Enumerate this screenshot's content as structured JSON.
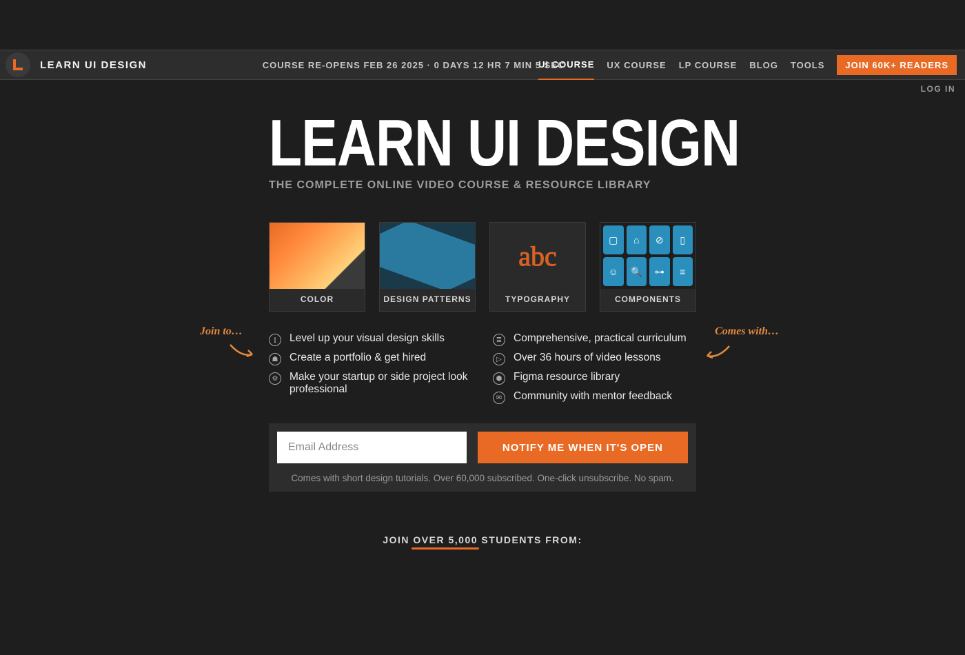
{
  "header": {
    "brand": "LEARN UI DESIGN",
    "countdown": "COURSE RE-OPENS FEB 26 2025 · 0 DAYS 12 HR 7 MIN 5 SEC",
    "nav": [
      {
        "label": "UI COURSE",
        "active": true
      },
      {
        "label": "UX COURSE",
        "active": false
      },
      {
        "label": "LP COURSE",
        "active": false
      },
      {
        "label": "BLOG",
        "active": false
      },
      {
        "label": "TOOLS",
        "active": false
      }
    ],
    "cta": "JOIN 60K+ READERS",
    "login": "LOG IN"
  },
  "hero": {
    "title": "LEARN UI DESIGN",
    "subtitle": "THE COMPLETE ONLINE VIDEO COURSE & RESOURCE LIBRARY"
  },
  "cards": [
    {
      "label": "COLOR"
    },
    {
      "label": "DESIGN PATTERNS"
    },
    {
      "label": "TYPOGRAPHY"
    },
    {
      "label": "COMPONENTS"
    }
  ],
  "annotations": {
    "left": "Join to…",
    "right": "Comes with…"
  },
  "benefits_left": [
    "Level up your visual design skills",
    "Create a portfolio & get hired",
    "Make your startup or side project look professional"
  ],
  "benefits_right": [
    "Comprehensive, practical curriculum",
    "Over 36 hours of video lessons",
    "Figma resource library",
    "Community with mentor feedback"
  ],
  "signup": {
    "placeholder": "Email Address",
    "button": "NOTIFY ME WHEN IT'S OPEN",
    "fineprint": "Comes with short design tutorials. Over 60,000 subscribed. One-click unsubscribe. No spam."
  },
  "students": {
    "prefix": "JOIN ",
    "highlight": "OVER 5,000",
    "suffix": " STUDENTS FROM:"
  }
}
